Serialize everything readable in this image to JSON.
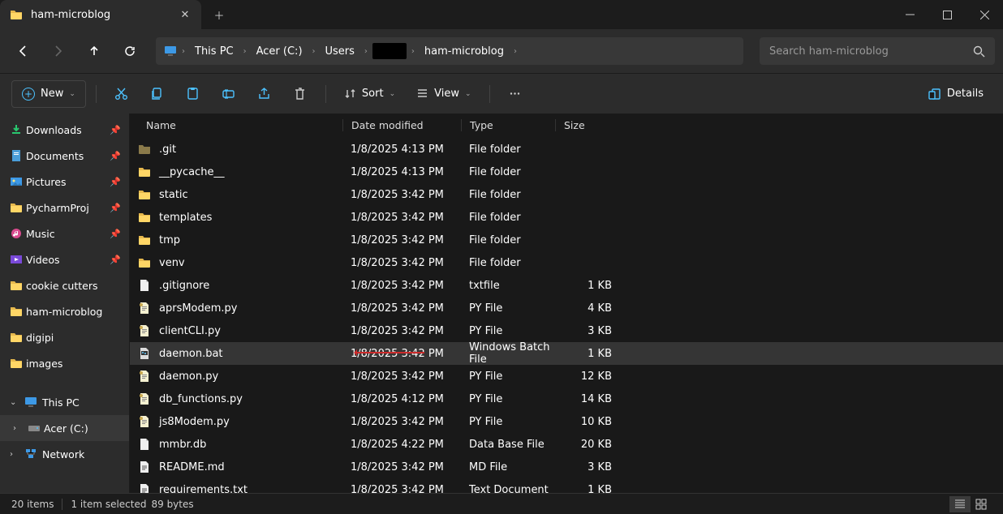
{
  "tab": {
    "title": "ham-microblog"
  },
  "addr": {
    "crumbs": [
      "This PC",
      "Acer (C:)",
      "Users",
      "",
      "ham-microblog"
    ]
  },
  "search": {
    "placeholder": "Search ham-microblog"
  },
  "toolbar": {
    "new": "New",
    "sort": "Sort",
    "view": "View",
    "details": "Details"
  },
  "columns": {
    "name": "Name",
    "date": "Date modified",
    "type": "Type",
    "size": "Size"
  },
  "sidebar": {
    "items": [
      {
        "label": "Downloads",
        "icon": "download",
        "pinned": true
      },
      {
        "label": "Documents",
        "icon": "document",
        "pinned": true
      },
      {
        "label": "Pictures",
        "icon": "pictures",
        "pinned": true
      },
      {
        "label": "PycharmProj",
        "icon": "folder",
        "pinned": true
      },
      {
        "label": "Music",
        "icon": "music",
        "pinned": true
      },
      {
        "label": "Videos",
        "icon": "videos",
        "pinned": true
      },
      {
        "label": "cookie cutters",
        "icon": "folder"
      },
      {
        "label": "ham-microblog",
        "icon": "folder"
      },
      {
        "label": "digipi",
        "icon": "folder"
      },
      {
        "label": "images",
        "icon": "folder"
      }
    ],
    "thispc": "This PC",
    "drive": "Acer (C:)",
    "network": "Network"
  },
  "files": [
    {
      "name": ".git",
      "date": "1/8/2025 4:13 PM",
      "type": "File folder",
      "size": "",
      "icon": "folder-dim"
    },
    {
      "name": "__pycache__",
      "date": "1/8/2025 4:13 PM",
      "type": "File folder",
      "size": "",
      "icon": "folder"
    },
    {
      "name": "static",
      "date": "1/8/2025 3:42 PM",
      "type": "File folder",
      "size": "",
      "icon": "folder"
    },
    {
      "name": "templates",
      "date": "1/8/2025 3:42 PM",
      "type": "File folder",
      "size": "",
      "icon": "folder"
    },
    {
      "name": "tmp",
      "date": "1/8/2025 3:42 PM",
      "type": "File folder",
      "size": "",
      "icon": "folder"
    },
    {
      "name": "venv",
      "date": "1/8/2025 3:42 PM",
      "type": "File folder",
      "size": "",
      "icon": "folder"
    },
    {
      "name": ".gitignore",
      "date": "1/8/2025 3:42 PM",
      "type": "txtfile",
      "size": "1 KB",
      "icon": "file"
    },
    {
      "name": "aprsModem.py",
      "date": "1/8/2025 3:42 PM",
      "type": "PY File",
      "size": "4 KB",
      "icon": "py"
    },
    {
      "name": "clientCLI.py",
      "date": "1/8/2025 3:42 PM",
      "type": "PY File",
      "size": "3 KB",
      "icon": "py"
    },
    {
      "name": "daemon.bat",
      "date": "1/8/2025 3:42 PM",
      "type": "Windows Batch File",
      "size": "1 KB",
      "icon": "bat",
      "selected": true
    },
    {
      "name": "daemon.py",
      "date": "1/8/2025 3:42 PM",
      "type": "PY File",
      "size": "12 KB",
      "icon": "py"
    },
    {
      "name": "db_functions.py",
      "date": "1/8/2025 4:12 PM",
      "type": "PY File",
      "size": "14 KB",
      "icon": "py"
    },
    {
      "name": "js8Modem.py",
      "date": "1/8/2025 3:42 PM",
      "type": "PY File",
      "size": "10 KB",
      "icon": "py"
    },
    {
      "name": "mmbr.db",
      "date": "1/8/2025 4:22 PM",
      "type": "Data Base File",
      "size": "20 KB",
      "icon": "file"
    },
    {
      "name": "README.md",
      "date": "1/8/2025 3:42 PM",
      "type": "MD File",
      "size": "3 KB",
      "icon": "txt"
    },
    {
      "name": "requirements.txt",
      "date": "1/8/2025 3:42 PM",
      "type": "Text Document",
      "size": "1 KB",
      "icon": "txt"
    }
  ],
  "status": {
    "count": "20 items",
    "selection": "1 item selected",
    "bytes": "89 bytes"
  }
}
